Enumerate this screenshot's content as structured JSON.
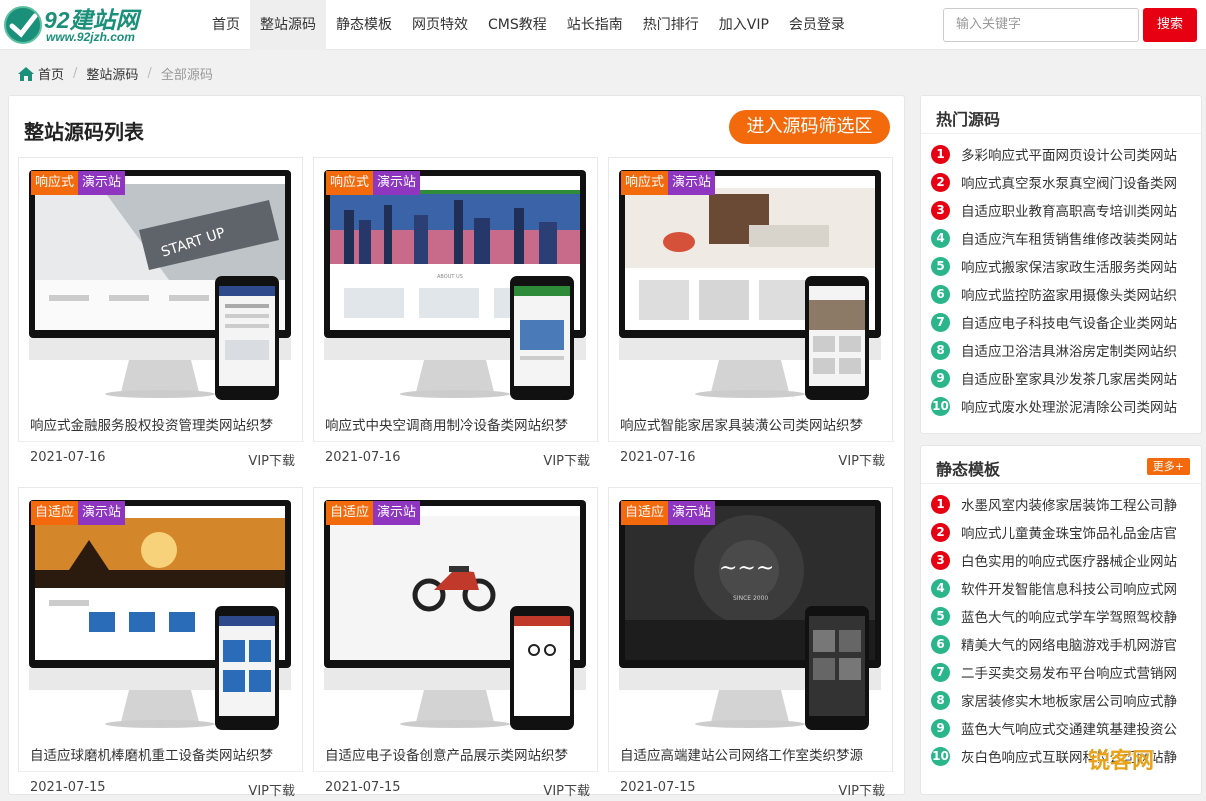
{
  "logo": {
    "text": "92建站网",
    "sub": "www.92jzh.com"
  },
  "nav": [
    {
      "label": "首页"
    },
    {
      "label": "整站源码"
    },
    {
      "label": "静态模板"
    },
    {
      "label": "网页特效"
    },
    {
      "label": "CMS教程"
    },
    {
      "label": "站长指南"
    },
    {
      "label": "热门排行"
    },
    {
      "label": "加入VIP"
    },
    {
      "label": "会员登录"
    }
  ],
  "search": {
    "placeholder": "输入关键字",
    "button": "搜索"
  },
  "breadcrumb": {
    "home": "首页",
    "section": "整站源码",
    "current": "全部源码",
    "sep": "/"
  },
  "main": {
    "title": "整站源码列表",
    "filter_button": "进入源码筛选区",
    "cards": [
      {
        "tag1": "响应式",
        "tag2": "演示站",
        "title": "响应式金融服务股权投资管理类网站织梦",
        "date": "2021-07-16",
        "vip": "VIP下载"
      },
      {
        "tag1": "响应式",
        "tag2": "演示站",
        "title": "响应式中央空调商用制冷设备类网站织梦",
        "date": "2021-07-16",
        "vip": "VIP下载"
      },
      {
        "tag1": "响应式",
        "tag2": "演示站",
        "title": "响应式智能家居家具装潢公司类网站织梦",
        "date": "2021-07-16",
        "vip": "VIP下载"
      },
      {
        "tag1": "自适应",
        "tag2": "演示站",
        "title": "自适应球磨机棒磨机重工设备类网站织梦",
        "date": "2021-07-15",
        "vip": "VIP下载"
      },
      {
        "tag1": "自适应",
        "tag2": "演示站",
        "title": "自适应电子设备创意产品展示类网站织梦",
        "date": "2021-07-15",
        "vip": "VIP下载"
      },
      {
        "tag1": "自适应",
        "tag2": "演示站",
        "title": "自适应高端建站公司网络工作室类织梦源",
        "date": "2021-07-15",
        "vip": "VIP下载"
      }
    ],
    "screen_texts": [
      "START UP",
      "ABOUT US",
      "SINCE 2000"
    ]
  },
  "hot": {
    "title": "热门源码",
    "items": [
      {
        "n": "1",
        "t": "多彩响应式平面网页设计公司类网站"
      },
      {
        "n": "2",
        "t": "响应式真空泵水泵真空阀门设备类网"
      },
      {
        "n": "3",
        "t": "自适应职业教育高职高专培训类网站"
      },
      {
        "n": "4",
        "t": "自适应汽车租赁销售维修改装类网站"
      },
      {
        "n": "5",
        "t": "响应式搬家保洁家政生活服务类网站"
      },
      {
        "n": "6",
        "t": "响应式监控防盗家用摄像头类网站织"
      },
      {
        "n": "7",
        "t": "自适应电子科技电气设备企业类网站"
      },
      {
        "n": "8",
        "t": "自适应卫浴洁具淋浴房定制类网站织"
      },
      {
        "n": "9",
        "t": "自适应卧室家具沙发茶几家居类网站"
      },
      {
        "n": "10",
        "t": "响应式废水处理淤泥清除公司类网站"
      }
    ]
  },
  "static": {
    "title": "静态模板",
    "more": "更多+",
    "items": [
      {
        "n": "1",
        "t": "水墨风室内装修家居装饰工程公司静"
      },
      {
        "n": "2",
        "t": "响应式儿童黄金珠宝饰品礼品金店官"
      },
      {
        "n": "3",
        "t": "白色实用的响应式医疗器械企业网站"
      },
      {
        "n": "4",
        "t": "软件开发智能信息科技公司响应式网"
      },
      {
        "n": "5",
        "t": "蓝色大气的响应式学车学驾照驾校静"
      },
      {
        "n": "6",
        "t": "精美大气的网络电脑游戏手机网游官"
      },
      {
        "n": "7",
        "t": "二手买卖交易发布平台响应式营销网"
      },
      {
        "n": "8",
        "t": "家居装修实木地板家居公司响应式静"
      },
      {
        "n": "9",
        "t": "蓝色大气响应式交通建筑基建投资公"
      },
      {
        "n": "10",
        "t": "灰白色响应式互联网科技公司网站静"
      }
    ]
  },
  "watermark": "锐客网",
  "colors": {
    "accent": "#f26a0c",
    "red": "#e60012",
    "purple": "#8e36c0",
    "green": "#2bb58a",
    "brand": "#1a8f7a"
  }
}
